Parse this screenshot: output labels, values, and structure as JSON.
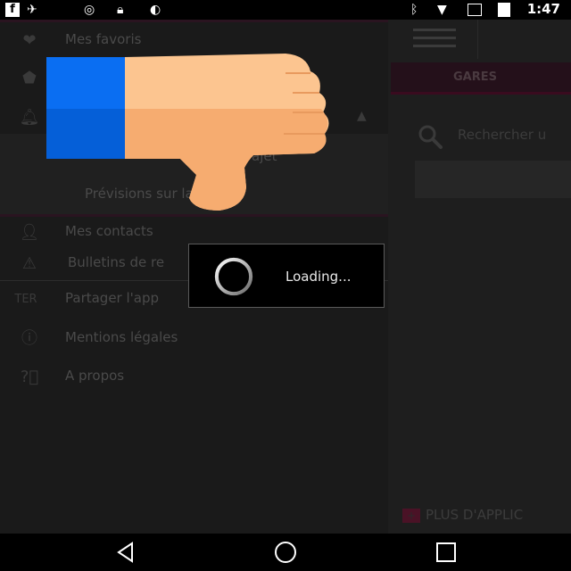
{
  "status_bar": {
    "time": "1:47",
    "left_icons": [
      "facebook-icon",
      "no-signal-satellite-icon",
      "sync-icon",
      "lock-icon",
      "android-icon"
    ],
    "right_icons": [
      "bluetooth-icon",
      "wifi-icon",
      "no-sim-icon",
      "battery-charging-icon"
    ]
  },
  "drawer": {
    "items": [
      {
        "label": "Mes favoris",
        "icon": "heart-icon"
      },
      {
        "label": "",
        "icon": "france-map-icon"
      },
      {
        "label": "",
        "icon": "bell-icon"
      },
      {
        "label": "Mes contacts",
        "icon": "person-icon"
      },
      {
        "label": "Bulletins de re",
        "icon": "warning-icon"
      },
      {
        "label": "Partager l'app",
        "icon": "ter-icon",
        "icon_text": "TER"
      },
      {
        "label": "Mentions légales",
        "icon": "info-icon"
      },
      {
        "label": "A propos",
        "icon": "question-icon"
      }
    ],
    "sub_items": [
      {
        "label": "trajet"
      },
      {
        "label": "Prévisions sur la région"
      }
    ]
  },
  "main": {
    "tab_label": "GARES",
    "search_placeholder": "Rechercher u",
    "more_apps_label": "PLUS D'APPLIC",
    "more_apps_icon_text": "+"
  },
  "loading_dialog": {
    "text": "Loading..."
  },
  "sticker": {
    "icon": "thumbs-down-icon"
  },
  "nav_bar": {
    "buttons": [
      "back-icon",
      "home-icon",
      "recents-icon"
    ]
  },
  "colors": {
    "accent": "#3a0b1f",
    "sleeve": "#0a6ef2",
    "skin": "#fcc590"
  }
}
